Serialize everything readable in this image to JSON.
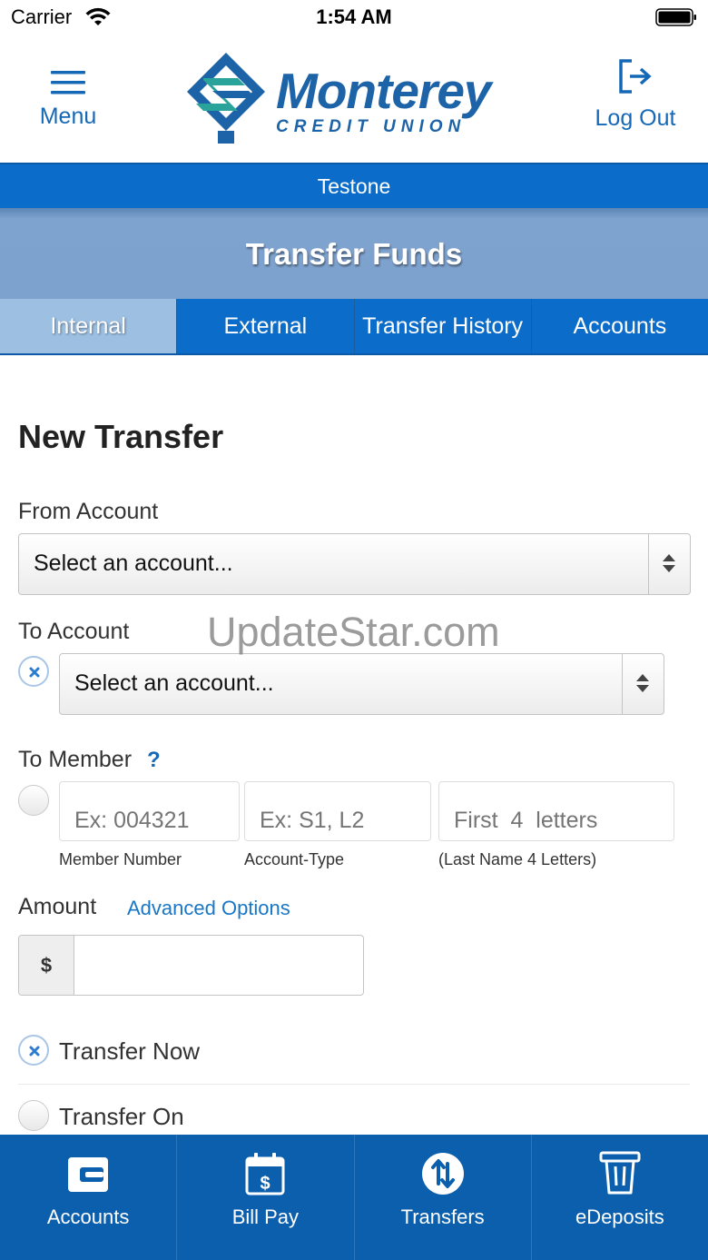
{
  "status_bar": {
    "carrier": "Carrier",
    "time": "1:54 AM",
    "wifi_icon": "wifi-icon",
    "battery_icon": "battery-icon"
  },
  "header": {
    "menu_label": "Menu",
    "menu_icon": "hamburger-icon",
    "logo_word": "Monterey",
    "logo_sub": "CREDIT UNION",
    "logout_label": "Log Out",
    "logout_icon": "logout-icon"
  },
  "user_band": {
    "username": "Testone"
  },
  "page": {
    "title": "Transfer Funds"
  },
  "tabs": [
    {
      "label": "Internal",
      "active": true
    },
    {
      "label": "External",
      "active": false
    },
    {
      "label": "Transfer History",
      "active": false
    },
    {
      "label": "Accounts",
      "active": false
    }
  ],
  "form": {
    "title": "New Transfer",
    "from_account": {
      "label": "From Account",
      "value": "Select an account..."
    },
    "to_account": {
      "label": "To Account",
      "value": "Select an account...",
      "selected": true
    },
    "to_member": {
      "label": "To Member",
      "help": "?",
      "selected": false,
      "member_number": {
        "placeholder": "Ex: 004321",
        "hint": "Member Number"
      },
      "account_type": {
        "placeholder": "Ex: S1, L2",
        "hint": "Account-Type"
      },
      "last_name": {
        "placeholder": "First  4  letters",
        "hint": "(Last Name  4  Letters)"
      }
    },
    "amount": {
      "label": "Amount",
      "advanced_link": "Advanced Options",
      "currency_symbol": "$",
      "value": ""
    },
    "timing_options": [
      {
        "label": "Transfer Now",
        "selected": true
      },
      {
        "label": "Transfer On",
        "selected": false
      }
    ]
  },
  "watermark": "UpdateStar.com",
  "bottom_nav": [
    {
      "label": "Accounts",
      "icon": "wallet-icon"
    },
    {
      "label": "Bill Pay",
      "icon": "calendar-dollar-icon"
    },
    {
      "label": "Transfers",
      "icon": "transfer-arrows-icon"
    },
    {
      "label": "eDeposits",
      "icon": "check-deposit-icon"
    }
  ],
  "colors": {
    "brand_blue": "#0b6cc9",
    "nav_blue": "#0b5fad",
    "title_bar": "#7ea2ce",
    "active_tab": "#9dbfe1",
    "link_blue": "#1977c6"
  }
}
